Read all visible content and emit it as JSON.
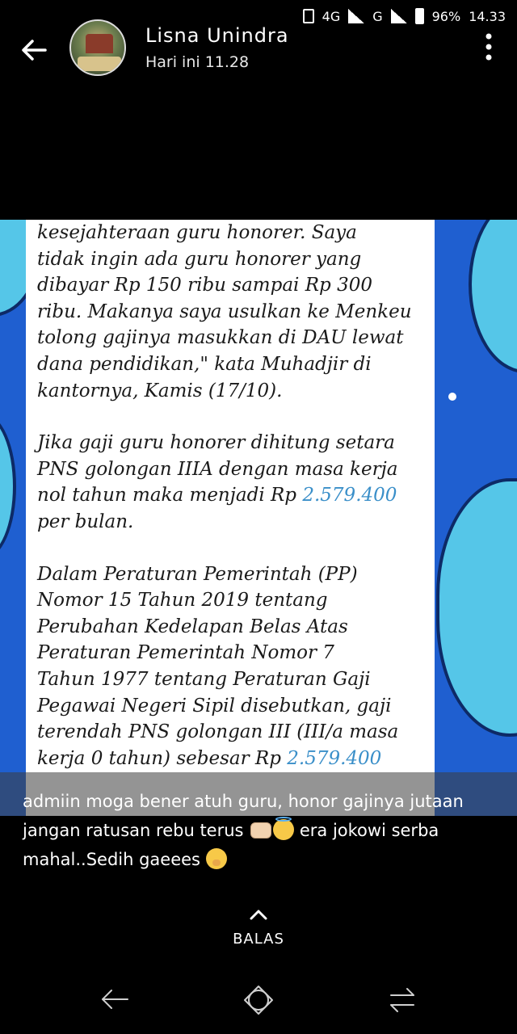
{
  "status_bar": {
    "network_1": "4G",
    "network_2": "G",
    "battery": "96%",
    "time": "14.33"
  },
  "header": {
    "sender_name": "Lisna Unindra",
    "post_time": "Hari ini 11.28",
    "back_icon": "arrow-left-icon",
    "menu_icon": "more-vertical-icon"
  },
  "article": {
    "p1": [
      "kesejahteraan guru honorer. Saya",
      "tidak ingin ada guru honorer yang",
      "dibayar Rp 150 ribu sampai Rp 300",
      "ribu. Makanya saya usulkan ke Menkeu",
      "tolong gajinya masukkan di DAU lewat",
      "dana pendidikan,\" kata Muhadjir di",
      "kantornya, Kamis (17/10)."
    ],
    "p2_l1": "Jika gaji guru honorer dihitung setara",
    "p2_l2": "PNS golongan IIIA dengan masa kerja",
    "p2_l3_pre": "nol tahun maka menjadi Rp ",
    "p2_amount": "2.579.400",
    "p2_l4": "per bulan.",
    "p3": [
      "Dalam Peraturan Pemerintah (PP)",
      "Nomor 15 Tahun 2019 tentang",
      "Perubahan Kedelapan Belas Atas",
      "Peraturan Pemerintah Nomor 7",
      "Tahun 1977 tentang Peraturan Gaji",
      "Pegawai Negeri Sipil disebutkan, gaji",
      "terendah PNS golongan III (III/a masa"
    ],
    "p3_l8_pre": "kerja 0 tahun) sebesar Rp ",
    "p3_amount": "2.579.400"
  },
  "caption": {
    "line1": "admiin moga bener atuh guru, honor gajinya jutaan",
    "line2_pre": "jangan ratusan rebu terus ",
    "line2_post": " era jokowi serba",
    "line3": "mahal..Sedih gaeees "
  },
  "reply": {
    "label": "BALAS"
  },
  "colors": {
    "background": "#000000",
    "story_bg": "#1f5fd0",
    "blob": "#55c6e8",
    "amount": "#3a8fc9"
  }
}
